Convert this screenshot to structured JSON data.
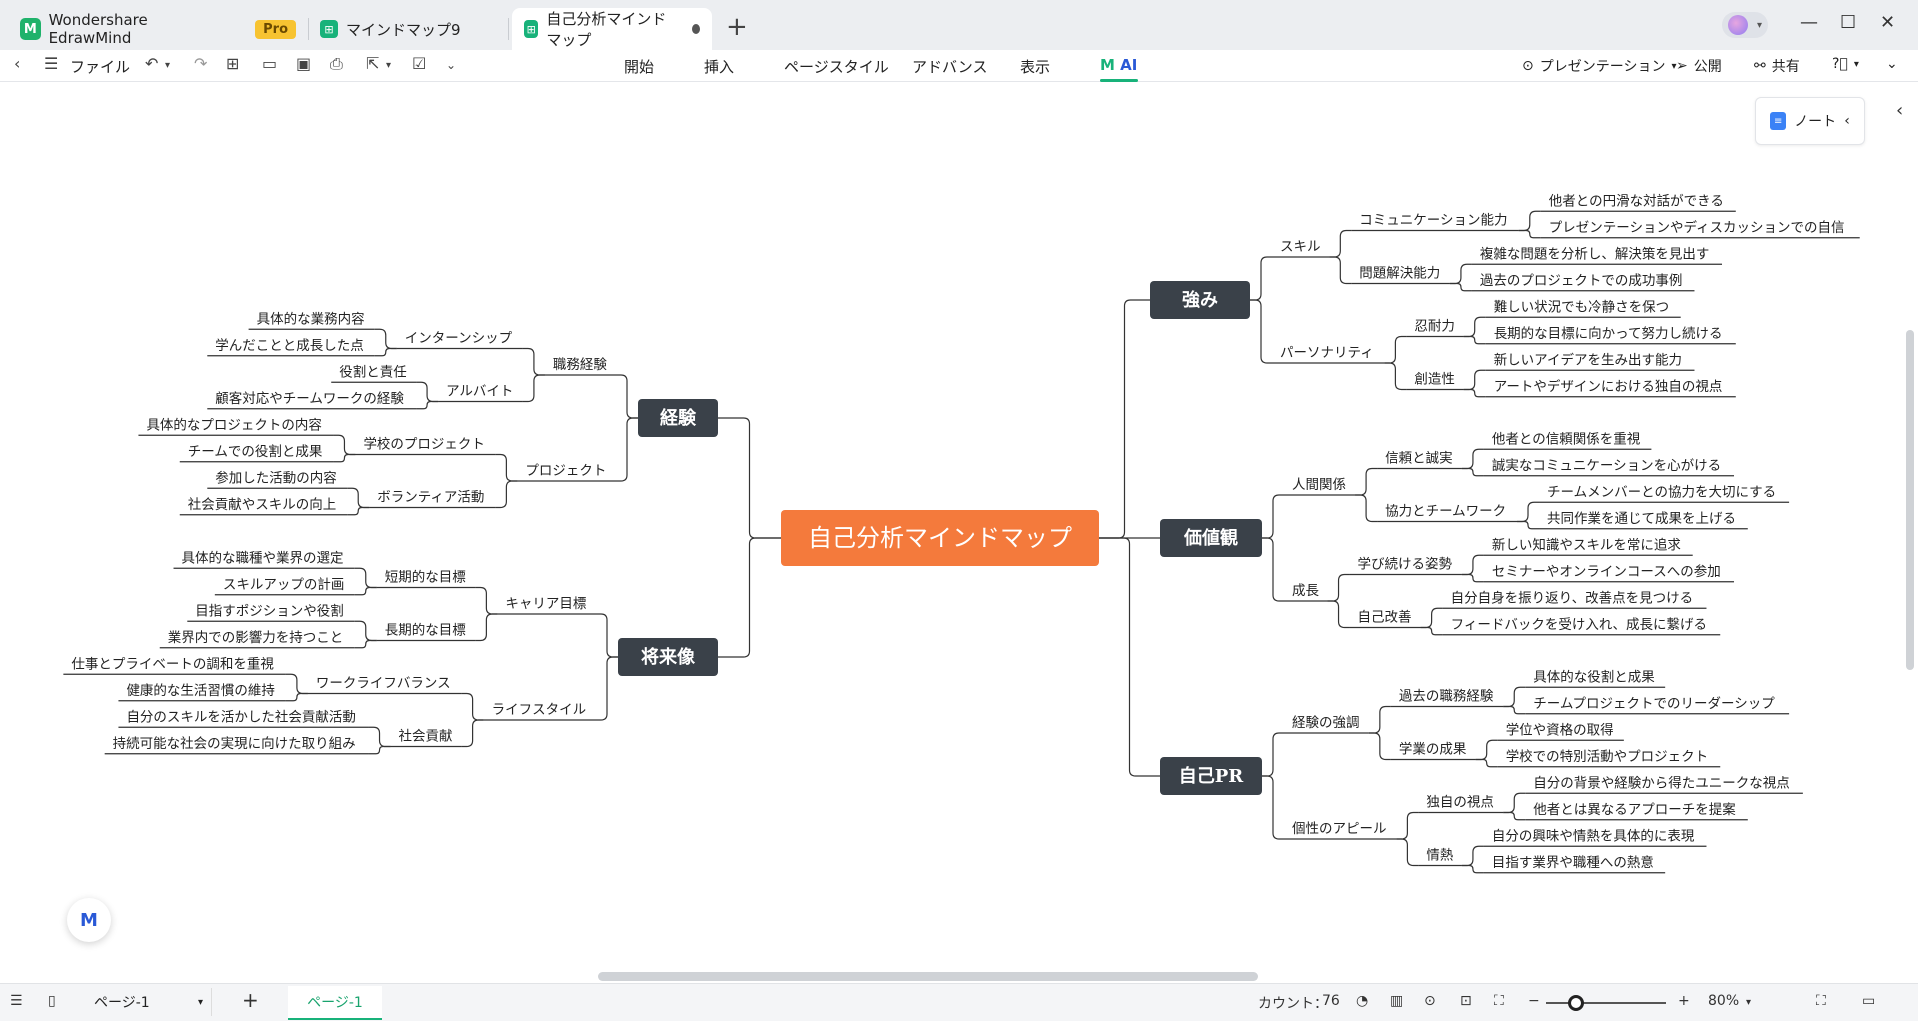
{
  "tabs": [
    {
      "label": "Wondershare EdrawMind",
      "badge": "Pro"
    },
    {
      "label": "マインドマップ9"
    },
    {
      "label": "自己分析マインドマップ"
    }
  ],
  "toolbar": {
    "file_label": "ファイル",
    "menus": [
      "開始",
      "挿入",
      "ページスタイル",
      "アドバンス",
      "表示",
      "AI"
    ],
    "presentation": "プレゼンテーション",
    "publish": "公開",
    "share": "共有"
  },
  "note_button": "ノート",
  "statusbar": {
    "page_select": "ページ-1",
    "page_tab": "ページ-1",
    "count_label": "カウント：",
    "count_value": "76",
    "zoom": "80%"
  },
  "colors": {
    "root": "#f47a3c",
    "main": "#3a4149",
    "accent": "#18b27a",
    "line": "#333333"
  },
  "mindmap": {
    "root": "自己分析マインドマップ",
    "experience": {
      "label": "経験",
      "work": {
        "label": "職務経験",
        "internship": {
          "label": "インターンシップ",
          "items": [
            "具体的な業務内容",
            "学んだことと成長した点"
          ]
        },
        "parttime": {
          "label": "アルバイト",
          "items": [
            "役割と責任",
            "顧客対応やチームワークの経験"
          ]
        }
      },
      "project": {
        "label": "プロジェクト",
        "school": {
          "label": "学校のプロジェクト",
          "items": [
            "具体的なプロジェクトの内容",
            "チームでの役割と成果"
          ]
        },
        "volunteer": {
          "label": "ボランティア活動",
          "items": [
            "参加した活動の内容",
            "社会貢献やスキルの向上"
          ]
        }
      }
    },
    "future": {
      "label": "将来像",
      "career": {
        "label": "キャリア目標",
        "short": {
          "label": "短期的な目標",
          "items": [
            "具体的な職種や業界の選定",
            "スキルアップの計画"
          ]
        },
        "long": {
          "label": "長期的な目標",
          "items": [
            "目指すポジションや役割",
            "業界内での影響力を持つこと"
          ]
        }
      },
      "life": {
        "label": "ライフスタイル",
        "wlb": {
          "label": "ワークライフバランス",
          "items": [
            "仕事とプライベートの調和を重視",
            "健康的な生活習慣の維持"
          ]
        },
        "social": {
          "label": "社会貢献",
          "items": [
            "自分のスキルを活かした社会貢献活動",
            "持続可能な社会の実現に向けた取り組み"
          ]
        }
      }
    },
    "strength": {
      "label": "強み",
      "skill": {
        "label": "スキル",
        "comm": {
          "label": "コミュニケーション能力",
          "items": [
            "他者との円滑な対話ができる",
            "プレゼンテーションやディスカッションでの自信"
          ]
        },
        "problem": {
          "label": "問題解決能力",
          "items": [
            "複雑な問題を分析し、解決策を見出す",
            "過去のプロジェクトでの成功事例"
          ]
        }
      },
      "personality": {
        "label": "パーソナリティ",
        "patience": {
          "label": "忍耐力",
          "items": [
            "難しい状況でも冷静さを保つ",
            "長期的な目標に向かって努力し続ける"
          ]
        },
        "creativity": {
          "label": "創造性",
          "items": [
            "新しいアイデアを生み出す能力",
            "アートやデザインにおける独自の視点"
          ]
        }
      }
    },
    "values": {
      "label": "価値観",
      "relation": {
        "label": "人間関係",
        "trust": {
          "label": "信頼と誠実",
          "items": [
            "他者との信頼関係を重視",
            "誠実なコミュニケーションを心がける"
          ]
        },
        "team": {
          "label": "協力とチームワーク",
          "items": [
            "チームメンバーとの協力を大切にする",
            "共同作業を通じて成果を上げる"
          ]
        }
      },
      "growth": {
        "label": "成長",
        "learn": {
          "label": "学び続ける姿勢",
          "items": [
            "新しい知識やスキルを常に追求",
            "セミナーやオンラインコースへの参加"
          ]
        },
        "improve": {
          "label": "自己改善",
          "items": [
            "自分自身を振り返り、改善点を見つける",
            "フィードバックを受け入れ、成長に繋げる"
          ]
        }
      }
    },
    "pr": {
      "label": "自己PR",
      "emph": {
        "label": "経験の強調",
        "pastwork": {
          "label": "過去の職務経験",
          "items": [
            "具体的な役割と成果",
            "チームプロジェクトでのリーダーシップ"
          ]
        },
        "academic": {
          "label": "学業の成果",
          "items": [
            "学位や資格の取得",
            "学校での特別活動やプロジェクト"
          ]
        }
      },
      "appeal": {
        "label": "個性のアピール",
        "unique": {
          "label": "独自の視点",
          "items": [
            "自分の背景や経験から得たユニークな視点",
            "他者とは異なるアプローチを提案"
          ]
        },
        "passion": {
          "label": "情熱",
          "items": [
            "自分の興味や情熱を具体的に表現",
            "目指す業界や職種への熱意"
          ]
        }
      }
    }
  }
}
